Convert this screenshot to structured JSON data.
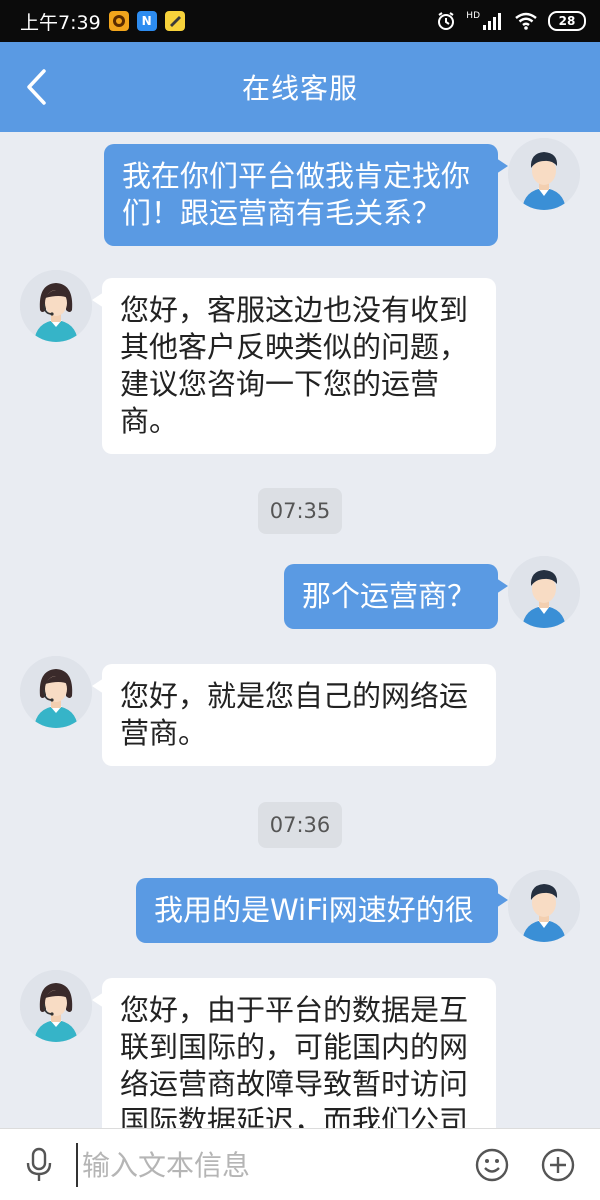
{
  "status_bar": {
    "time": "上午7:39",
    "app_badges": [
      "app-badge-1",
      "app-badge-2",
      "app-badge-3"
    ],
    "badge_2_letter": "N",
    "signal_label": "HD",
    "battery": "28"
  },
  "header": {
    "title": "在线客服",
    "background": "#5a9ae3"
  },
  "messages": [
    {
      "sender": "user",
      "text": "我在你们平台做我肯定找你们！跟运营商有毛关系？"
    },
    {
      "sender": "agent",
      "text": "您好，客服这边也没有收到其他客户反映类似的问题，建议您咨询一下您的运营商。"
    },
    {
      "type": "time",
      "text": "07:35"
    },
    {
      "sender": "user",
      "text": "那个运营商？"
    },
    {
      "sender": "agent",
      "text": "您好，就是您自己的网络运营商。"
    },
    {
      "type": "time",
      "text": "07:36"
    },
    {
      "sender": "user",
      "text": "我用的是WiFi网速好的很"
    },
    {
      "sender": "agent",
      "text": "您好，由于平台的数据是互联到国际的，可能国内的网络运营商故障导致暂时访问国际数据延迟，而我们公司"
    }
  ],
  "input": {
    "placeholder": "输入文本信息",
    "value": ""
  },
  "colors": {
    "user_bubble": "#5a9ae3",
    "agent_bubble": "#ffffff",
    "chat_background": "#e9ecf2"
  }
}
